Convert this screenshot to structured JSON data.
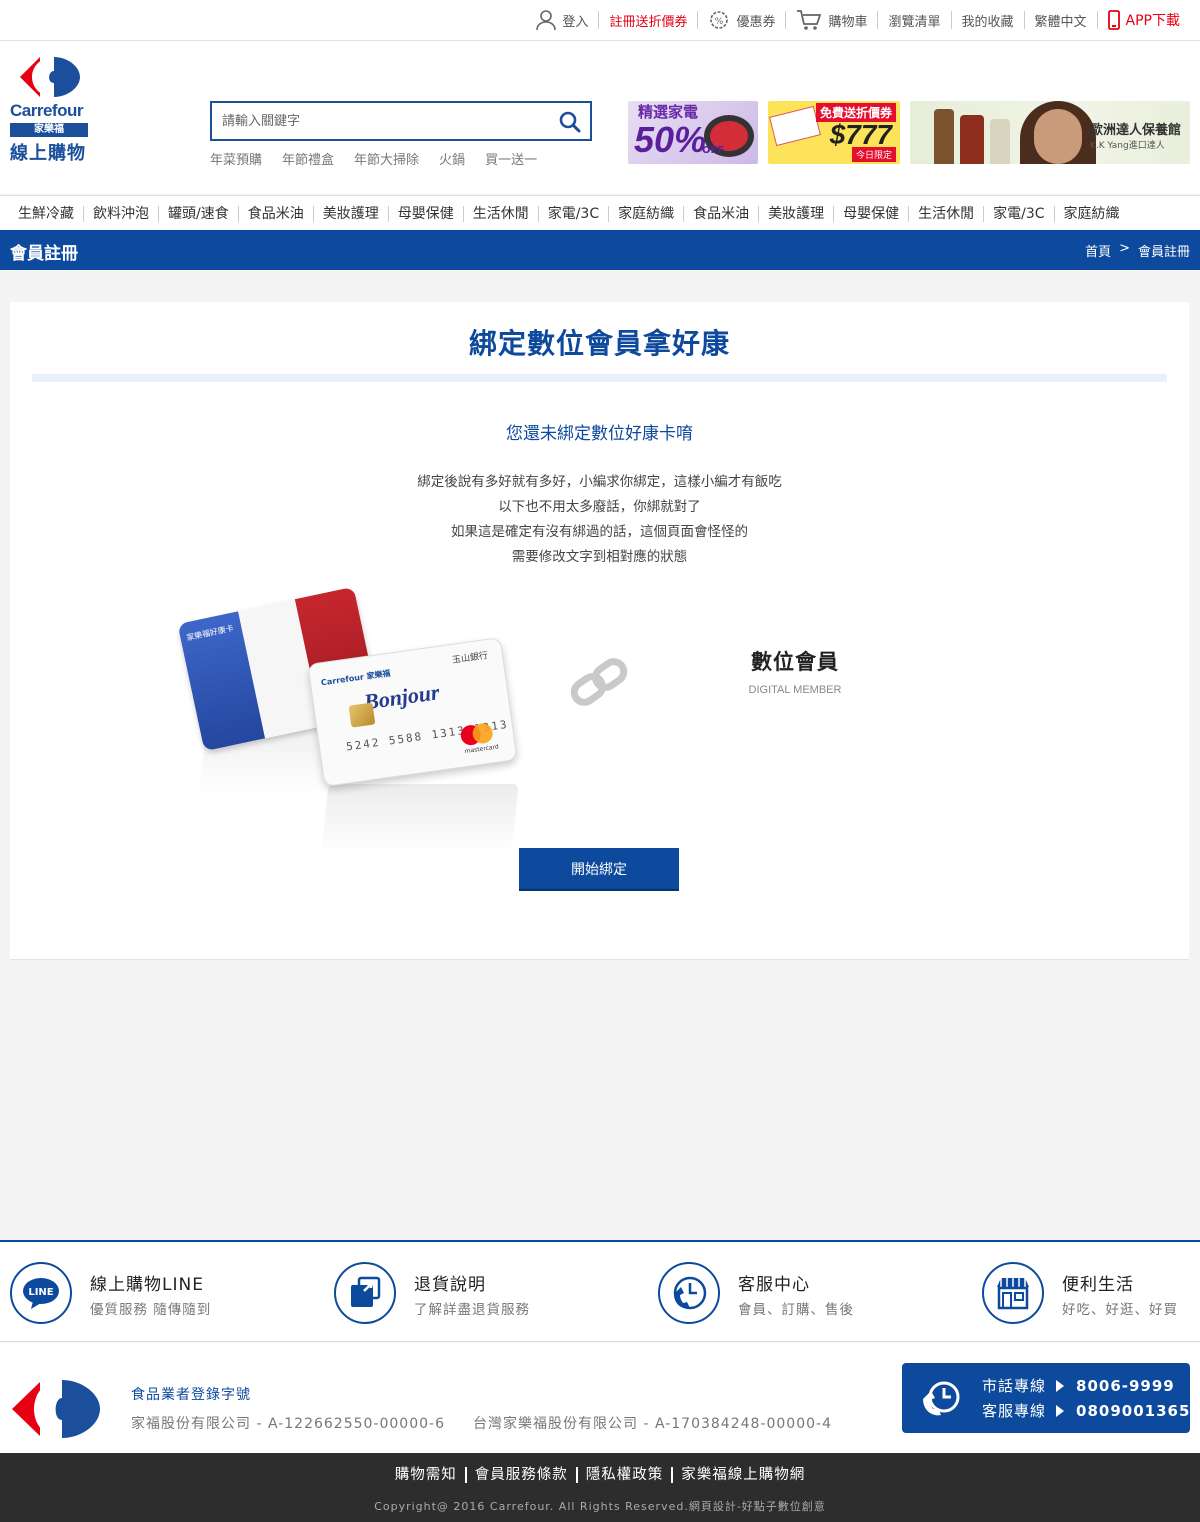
{
  "topbar": {
    "items": [
      {
        "label": "登入",
        "icon": "user-icon"
      },
      {
        "label": "註冊送折價券",
        "color": "#e60012"
      },
      {
        "label": "優惠券",
        "icon": "coupon-gear-icon"
      },
      {
        "label": "購物車",
        "icon": "cart-icon"
      },
      {
        "label": "瀏覽清單"
      },
      {
        "label": "我的收藏"
      },
      {
        "label": "繁體中文"
      },
      {
        "label": "APP下載",
        "icon": "phone-icon",
        "color": "#e60012"
      }
    ]
  },
  "header": {
    "logo": {
      "brand": "Carrefour",
      "badge": "家樂福",
      "online": "線上購物"
    },
    "search": {
      "placeholder": "請輸入關鍵字"
    },
    "hotkeys": [
      "年菜預購",
      "年節禮盒",
      "年節大掃除",
      "火鍋",
      "買一送一"
    ],
    "banners": {
      "b1": {
        "title": "精選家電",
        "big": "50%",
        "off": "OFF"
      },
      "b2": {
        "tag": "免費送折價券",
        "amount": "$777",
        "note": "今日限定"
      },
      "b3": {
        "title": "歐洲達人保養館",
        "sub": "K.K Yang進口達人"
      }
    }
  },
  "categories": [
    "生鮮冷藏",
    "飲料沖泡",
    "罐頭/速食",
    "食品米油",
    "美妝護理",
    "母嬰保健",
    "生活休閒",
    "家電/3C",
    "家庭紡織",
    "食品米油",
    "美妝護理",
    "母嬰保健",
    "生活休閒",
    "家電/3C",
    "家庭紡織"
  ],
  "titlebar": {
    "title": "會員註冊",
    "crumb_home": "首頁",
    "crumb_sep": ">",
    "crumb_current": "會員註冊"
  },
  "main": {
    "heading": "綁定數位會員拿好康",
    "subheading": "您還未綁定數位好康卡唷",
    "desc": [
      "綁定後說有多好就有多好，小編求你綁定，這樣小編才有飯吃",
      "以下也不用太多廢話，你綁就對了",
      "如果這是確定有沒有綁過的話，這個頁面會怪怪的",
      "需要修改文字到相對應的狀態"
    ],
    "card": {
      "card1_label": "家樂福好康卡",
      "card2_brand": "Carrefour 家樂福",
      "card2_bank": "玉山銀行",
      "card2_word": "Bonjour",
      "card2_number": "5242 5588 1313 1313",
      "card2_net": "mastercard"
    },
    "member_title": "數位會員",
    "member_sub": "DIGITAL MEMBER",
    "start_button": "開始綁定"
  },
  "services": [
    {
      "title": "線上購物LINE",
      "sub": "優質服務 隨傳隨到",
      "icon": "line-icon"
    },
    {
      "title": "退貨說明",
      "sub": "了解詳盡退貨服務",
      "icon": "return-box-icon"
    },
    {
      "title": "客服中心",
      "sub": "會員、訂購、售後",
      "icon": "phone-clock-icon"
    },
    {
      "title": "便利生活",
      "sub": "好吃、好逛、好買",
      "icon": "store-icon"
    }
  ],
  "footer": {
    "reg_title": "食品業者登錄字號",
    "companies": [
      "家福股份有限公司 - A-122662550-00000-6",
      "台灣家樂福股份有限公司 - A-170384248-00000-4"
    ],
    "hotline": [
      {
        "label": "市話專線",
        "number": "8006-9999"
      },
      {
        "label": "客服專線",
        "number": "0809001365"
      }
    ],
    "links": [
      "購物需知",
      "會員服務條款",
      "隱私權政策",
      "家樂福線上購物網"
    ],
    "copyright": "Copyright@ 2016 Carrefour. All Rights Reserved.網頁設計-好點子數位創意"
  },
  "colors": {
    "brand_blue": "#0d4a9d",
    "brand_red": "#e60012"
  }
}
